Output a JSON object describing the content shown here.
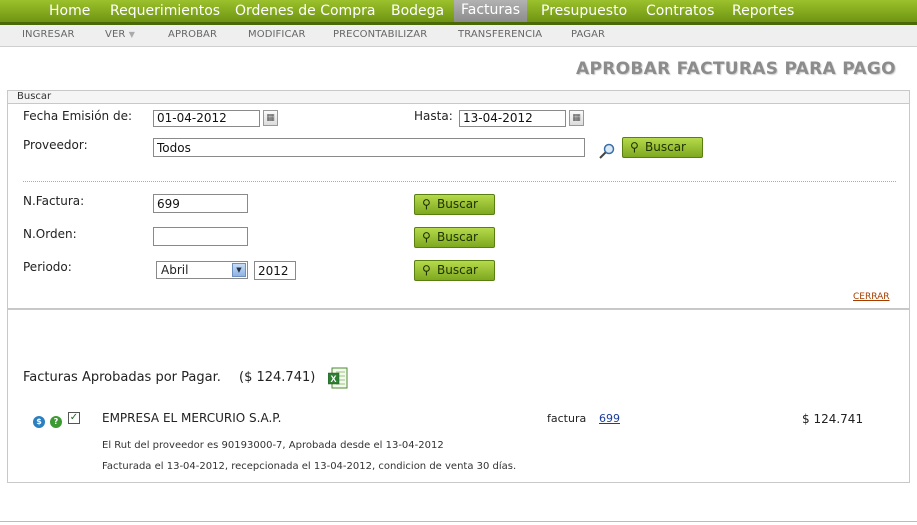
{
  "nav": {
    "items": [
      {
        "label": "Home"
      },
      {
        "label": "Requerimientos"
      },
      {
        "label": "Ordenes de Compra"
      },
      {
        "label": "Bodega"
      },
      {
        "label": "Facturas"
      },
      {
        "label": "Presupuesto"
      },
      {
        "label": "Contratos"
      },
      {
        "label": "Reportes"
      }
    ],
    "active": "Facturas"
  },
  "subnav": {
    "items": [
      {
        "label": "INGRESAR"
      },
      {
        "label": "VER"
      },
      {
        "label": "APROBAR"
      },
      {
        "label": "MODIFICAR"
      },
      {
        "label": "PRECONTABILIZAR"
      },
      {
        "label": "TRANSFERENCIA"
      },
      {
        "label": "PAGAR"
      }
    ],
    "ver_arrow": "▼"
  },
  "page_title": "APROBAR FACTURAS PARA PAGO",
  "search": {
    "header": "Buscar",
    "fecha_label": "Fecha Emisión de:",
    "fecha_desde": "01-04-2012",
    "hasta_label": "Hasta:",
    "fecha_hasta": "13-04-2012",
    "proveedor_label": "Proveedor:",
    "proveedor_value": "Todos",
    "buscar_label": "Buscar",
    "factura_label": "N.Factura:",
    "factura_value": "699",
    "orden_label": "N.Orden:",
    "orden_value": "",
    "periodo_label": "Periodo:",
    "periodo_mes": "Abril",
    "periodo_anio": "2012",
    "cerrar_label": "CERRAR"
  },
  "results": {
    "title": "Facturas Aprobadas por Pagar.",
    "total": "($ 124.741)",
    "rows": [
      {
        "proveedor": "EMPRESA EL MERCURIO S.A.P.",
        "tipo": "factura",
        "numero": "699",
        "monto": "$ 124.741",
        "detalle1": "El Rut del proveedor es 90193000-7, Aprobada desde el 13-04-2012",
        "detalle2": "Facturada el 13-04-2012, recepcionada el 13-04-2012, condicion de venta 30 días."
      }
    ]
  },
  "colors": {
    "nav_green": "#8cb324",
    "button_green": "#9cc63a",
    "link": "#1a3d99"
  }
}
